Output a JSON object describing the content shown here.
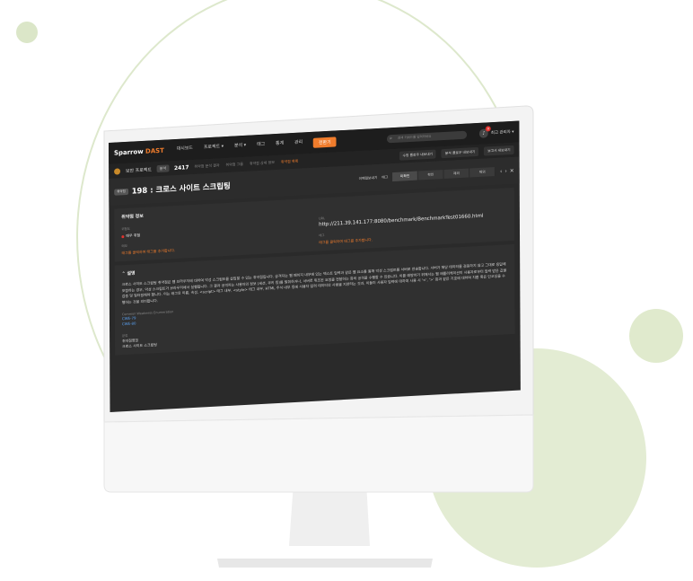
{
  "app": {
    "logo_main": "Sparrow",
    "logo_accent": "DAST",
    "menu": [
      "대시보드",
      "프로젝트 ▾",
      "분석 ▾",
      "태그",
      "통계",
      "관리"
    ],
    "active_menu": "전환기",
    "search_placeholder": "검색 키워드를 입력하세요",
    "notification_count": "8",
    "user_name": "최고 관리자 ▾"
  },
  "subbar": {
    "project_name": "보안 프로젝트",
    "scan_pill": "분석",
    "scan_number": "2417",
    "crumbs": [
      "취약점 분석 결과",
      "취약점 그룹",
      "취약점 상세 정보",
      "취약점 목록"
    ],
    "tools": [
      "수정 플로우 내보내기",
      "분석 플로우 내보내기",
      "보고서 내보내기"
    ]
  },
  "title": {
    "tag": "취약점",
    "text": "198 : 크로스 사이트 스크립팅",
    "actions": [
      "이메일보내기",
      "태그"
    ],
    "segments": [
      "미확인",
      "확인",
      "제외",
      "제외"
    ],
    "nav": [
      "‹",
      "›",
      "✕"
    ]
  },
  "info": {
    "heading": "취약점 정보",
    "risk_label": "위험도",
    "risk_value": "매우 위험",
    "url_label": "URL",
    "url_value": "http://211.39.141.177:8080/benchmark/BenchmarkTest01660.html",
    "tag_label": "태그",
    "tag_link_left": "태그를 클릭하여 태그를 추가합니다.",
    "comment_label": "메모",
    "comment_link": "태그를 클릭하여 태그를 추가합니다."
  },
  "description": {
    "heading": "설명",
    "body": "크로스 사이트 스크립팅 취약점은 웹 브라우저에 대하여 악성 스크립트를 삽입할 수 있는 취약점입니다. 공격자는 웹 페이지 내부에 있는 텍스트 입력과 같은 웹 요소를 통해 악성 스크립트를 서버로 전송합니다. 서버가 해당 데이터를 검증하지 않고 그대로 응답에 포함하는 경우, 악성 스크립트가 브라우저에서 실행됩니다. 그 결과 공격자는 사용자의 정보 (세션, 쿠키 등)를 탈취하거나, 서버로 위조된 요청을 전달하는 등의 공격을 수행할 수 있습니다. 이를 예방하기 위해서는 웹 애플리케이션이 사용자로부터 입력 받은 값을 검증 및 필터링해야 합니다. 이는 태그의 이름, 속성, <script> 태그 내부, <style> 태그 내부, HTML 주석 내부 등에 사용자 입력 데이터의 사용을 지양하는 것과, 이들이 사용자 입력에 대하여 사용 시 '<', '>' 등과 같은 기호에 대하여 치환 혹은 인코딩을 수행하는 것을 의미합니다.",
    "cwe_label": "Common Weakness Enumeration",
    "cwe": [
      "CWE-79",
      "CWE-80"
    ],
    "sub_label": "분류",
    "sub_lines": [
      "취약점명칭",
      "크로스 사이트 스크립팅"
    ]
  }
}
